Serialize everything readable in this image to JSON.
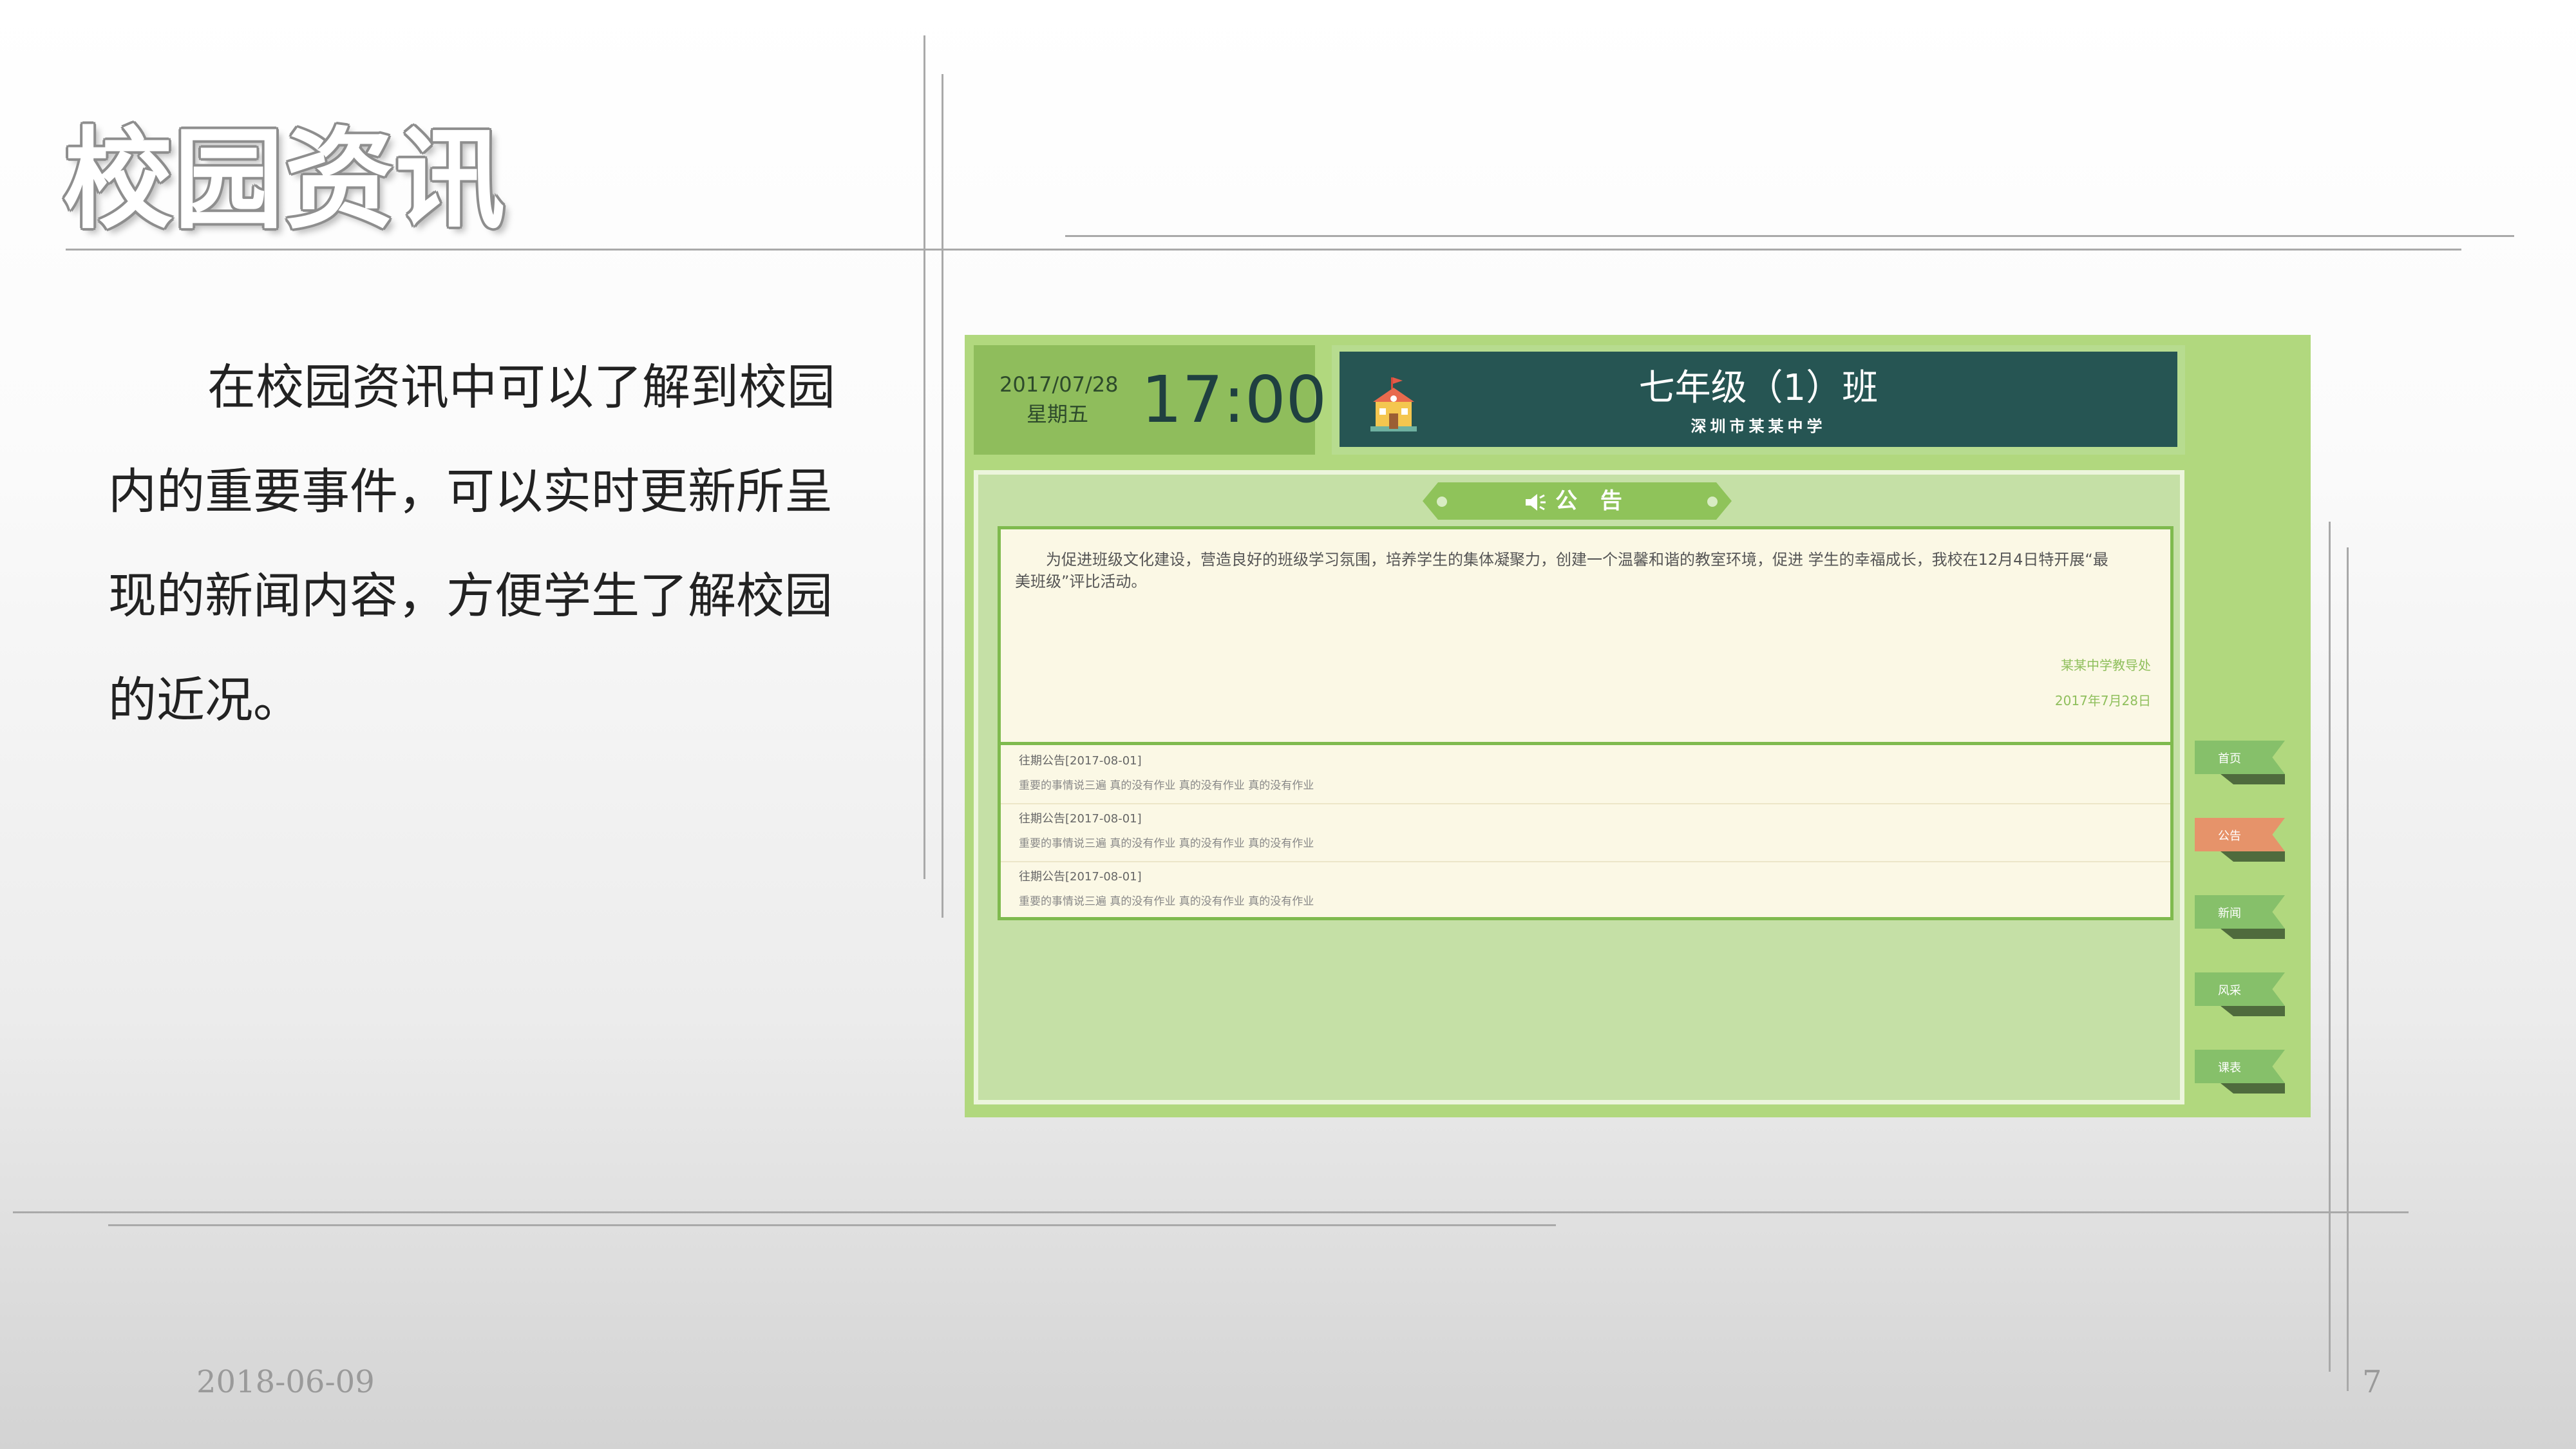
{
  "slide": {
    "title": "校园资讯",
    "body": "在校园资讯中可以了解到校园内的重要事件，可以实时更新所呈现的新闻内容，方便学生了解校园的近况。",
    "footer_date": "2018-06-09",
    "page_number": "7"
  },
  "screenshot": {
    "header": {
      "date": "2017/07/28",
      "weekday": "星期五",
      "time": "17:00",
      "class_name": "七年级（1）班",
      "school_name": "深圳市某某中学"
    },
    "notice": {
      "banner_label": "公 告",
      "text": "为促进班级文化建设，营造良好的班级学习氛围，培养学生的集体凝聚力，创建一个温馨和谐的教室环境，促进 学生的幸福成长，我校在12月4日特开展“最美班级”评比活动。",
      "signature": "某某中学教导处",
      "date": "2017年7月28日"
    },
    "past_notices": [
      {
        "title": "往期公告[2017-08-01]",
        "desc": "重要的事情说三遍 真的没有作业 真的没有作业 真的没有作业"
      },
      {
        "title": "往期公告[2017-08-01]",
        "desc": "重要的事情说三遍 真的没有作业 真的没有作业 真的没有作业"
      },
      {
        "title": "往期公告[2017-08-01]",
        "desc": "重要的事情说三遍 真的没有作业 真的没有作业 真的没有作业"
      }
    ],
    "side_nav": [
      {
        "label": "首页",
        "active": false
      },
      {
        "label": "公告",
        "active": true
      },
      {
        "label": "新闻",
        "active": false
      },
      {
        "label": "风采",
        "active": false
      },
      {
        "label": "课表",
        "active": false
      }
    ],
    "colors": {
      "outer_green": "#b1d87e",
      "date_green": "#8fbd5c",
      "class_teal": "#265553",
      "content_green": "#c5e0a6",
      "card_bg": "#fbf8e5",
      "tab_green": "#86c06a",
      "tab_active": "#e6936a"
    }
  }
}
